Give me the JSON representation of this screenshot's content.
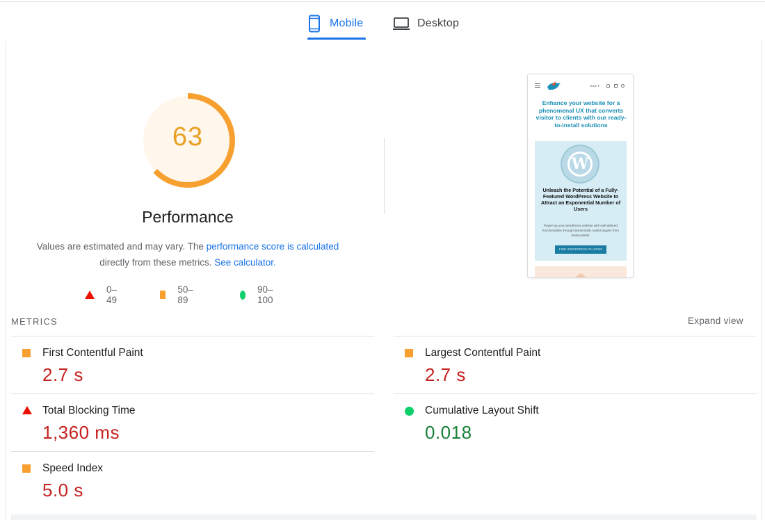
{
  "tabs": [
    {
      "label": "Mobile",
      "icon": "smartphone-icon",
      "active": true
    },
    {
      "label": "Desktop",
      "icon": "laptop-icon",
      "active": false
    }
  ],
  "score": {
    "value": "63",
    "fraction": 0.63,
    "color": "#f7a02f",
    "background": "#fff6ec",
    "title": "Performance"
  },
  "description": {
    "prefix": "Values are estimated and may vary. The ",
    "link1": "performance score is calculated",
    "middle": " directly from these metrics. ",
    "link2": "See calculator."
  },
  "legend": [
    {
      "range": "0–49",
      "shape": "triangle",
      "color": "#eb0f00"
    },
    {
      "range": "50–89",
      "shape": "square",
      "color": "#f7a02f"
    },
    {
      "range": "90–100",
      "shape": "circle",
      "color": "#0cce6b"
    }
  ],
  "screenshot": {
    "currency": "USD ▾",
    "hero": "Enhance your website for a phenomenal UX that converts visitor to clients with our ready-to-install solutions",
    "wp_logo": "W",
    "card_title": "Unleash the Potential of a Fully-Featured WordPress Website to Attract an Exponential Number of Users",
    "card_body": "Power-up your WordPress website with well-defined functionalities through dynamically coded plugins from ZealousWeb.",
    "card_button": "FIND WORDPRESS PLUGINS"
  },
  "metrics": {
    "label": "METRICS",
    "expand": "Expand view",
    "items": [
      {
        "name": "First Contentful Paint",
        "value": "2.7 s",
        "status": "average"
      },
      {
        "name": "Largest Contentful Paint",
        "value": "2.7 s",
        "status": "average"
      },
      {
        "name": "Total Blocking Time",
        "value": "1,360 ms",
        "status": "fail"
      },
      {
        "name": "Cumulative Layout Shift",
        "value": "0.018",
        "status": "pass"
      },
      {
        "name": "Speed Index",
        "value": "5.0 s",
        "status": "average"
      }
    ]
  }
}
